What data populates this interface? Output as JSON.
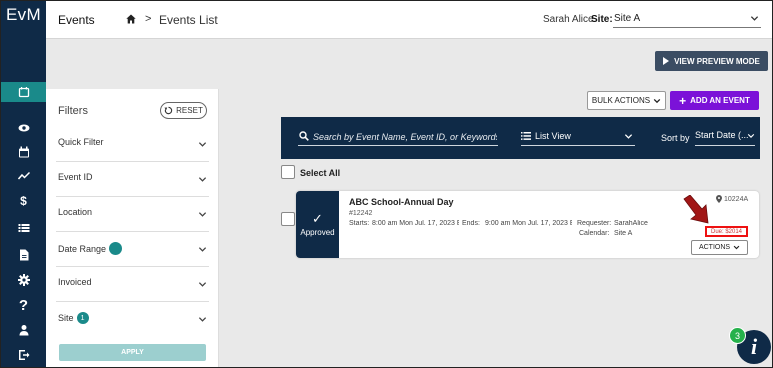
{
  "app": {
    "logo": "EvM"
  },
  "header": {
    "section": "Events",
    "breadcrumb_sep": ">",
    "breadcrumb_current": "Events List",
    "user": "Sarah Alice",
    "site_label": "Site:",
    "site_value": "Site A"
  },
  "sidebar": {
    "items": [
      {
        "icon": "calendar-icon",
        "active": true
      },
      {
        "icon": "eye-icon"
      },
      {
        "icon": "calendar-icon"
      },
      {
        "icon": "trend-chart-icon"
      },
      {
        "icon": "dollar-icon"
      },
      {
        "icon": "list-icon"
      },
      {
        "icon": "document-icon"
      },
      {
        "icon": "gear-icon"
      },
      {
        "icon": "help-icon"
      },
      {
        "icon": "user-icon"
      },
      {
        "icon": "logout-icon"
      }
    ]
  },
  "toolbar": {
    "preview_label": "VIEW PREVIEW MODE",
    "bulk_label": "BULK ACTIONS",
    "add_label": "ADD AN EVENT"
  },
  "filters": {
    "title": "Filters",
    "reset_label": "RESET",
    "items": [
      {
        "label": "Quick Filter"
      },
      {
        "label": "Event ID"
      },
      {
        "label": "Location"
      },
      {
        "label": "Date Range"
      },
      {
        "label": "Invoiced"
      },
      {
        "label": "Site",
        "count": "1"
      }
    ],
    "apply_label": "APPLY"
  },
  "search": {
    "placeholder": "Search by Event Name, Event ID, or Keywords",
    "view_label": "List View",
    "sort_label": "Sort by",
    "sort_value": "Start Date (..."
  },
  "list": {
    "select_all_label": "Select All",
    "events": [
      {
        "status": "Approved",
        "title": "ABC School-Annual Day",
        "id": "#12242",
        "starts_label": "Starts:",
        "starts_value": "8:00 am Mon Jul. 17, 2023 E",
        "ends_label": "Ends:",
        "ends_value": "9:00 am Mon Jul. 17, 2023 E",
        "requester_label": "Requester:",
        "requester_value": "SarahAlice",
        "calendar_label": "Calendar:",
        "calendar_value": "Site A",
        "location": "10224A",
        "due": "Due: $2014",
        "actions_label": "ACTIONS"
      }
    ]
  },
  "help": {
    "glyph": "i",
    "badge": "3"
  },
  "colors": {
    "navy": "#0f2a47",
    "teal": "#1a8a8a",
    "purple": "#7b12d8",
    "highlight": "#e11111"
  }
}
